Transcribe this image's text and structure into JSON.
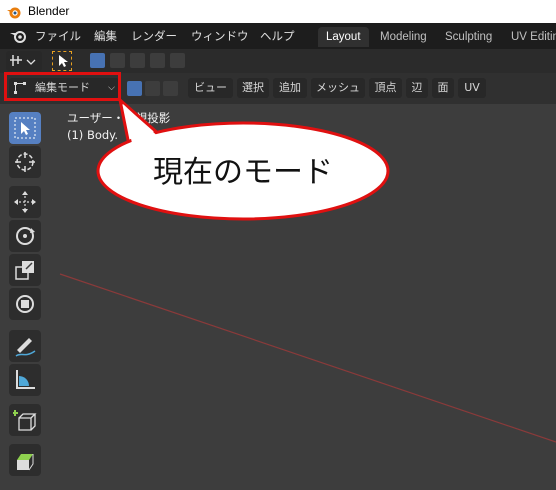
{
  "window": {
    "title": "Blender"
  },
  "menu": {
    "items": [
      "ファイル",
      "編集",
      "レンダー",
      "ウィンドウ",
      "ヘルプ"
    ]
  },
  "workspaces": {
    "tabs": [
      "Layout",
      "Modeling",
      "Sculpting",
      "UV Editin"
    ],
    "active": "Layout"
  },
  "header": {
    "mode_label": "編集モード",
    "menus": [
      "ビュー",
      "選択",
      "追加",
      "メッシュ",
      "頂点",
      "辺",
      "面",
      "UV"
    ]
  },
  "viewport": {
    "view_label": "ユーザー・透視投影",
    "object_label": "(1) Body."
  },
  "callout": {
    "text": "現在のモード"
  },
  "colors": {
    "accent": "#4772b3",
    "highlight_red": "#e01010",
    "x_axis": "#8a3a3a"
  }
}
